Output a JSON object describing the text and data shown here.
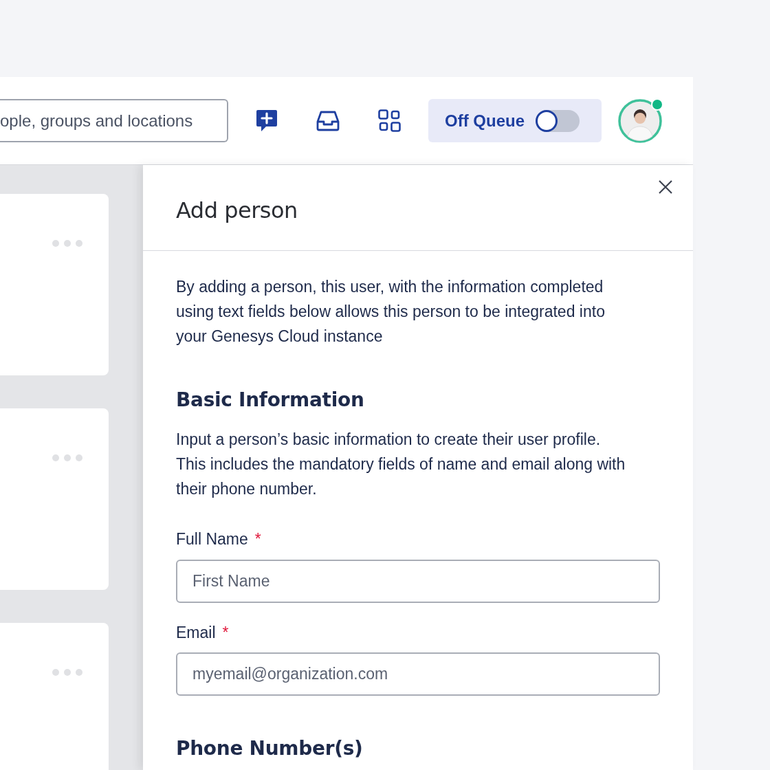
{
  "header": {
    "search": {
      "placeholder": "ople, groups and locations"
    },
    "queue_toggle": {
      "label": "Off Queue",
      "on": false
    },
    "avatar": {
      "online": true
    }
  },
  "cards": [
    {
      "kind": "card"
    },
    {
      "kind": "card"
    },
    {
      "kind": "card"
    }
  ],
  "panel": {
    "title": "Add person",
    "intro": "By adding a person, this user, with the information completed using text fields below allows this person to be integrated into your Genesys Cloud instance",
    "sections": [
      {
        "heading": "Basic Information",
        "description": "Input a person’s basic information to create their user profile. This includes the mandatory fields of name and email along with their phone number.",
        "fields": [
          {
            "label": "Full Name",
            "required": true,
            "required_mark": "*",
            "placeholder": "First Name"
          },
          {
            "label": "Email",
            "required": true,
            "required_mark": "*",
            "placeholder": "myemail@organization.com"
          }
        ]
      },
      {
        "heading": "Phone Number(s)"
      }
    ]
  }
}
